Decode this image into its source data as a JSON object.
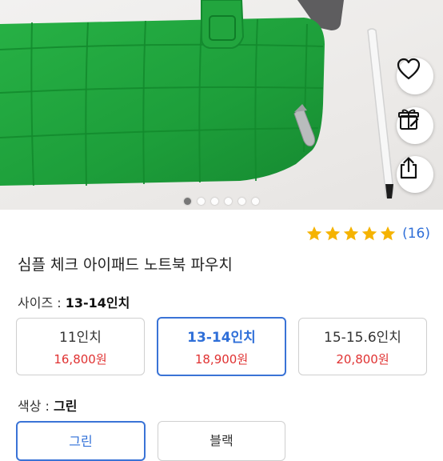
{
  "product": {
    "title": "심플 체크 아이패드 노트북 파우치",
    "rating": {
      "stars": 5,
      "review_count": "(16)"
    },
    "image_dots": {
      "count": 6,
      "active_index": 0
    }
  },
  "size_option": {
    "label": "사이즈 : ",
    "selected": "13-14인치",
    "choices": [
      {
        "name": "11인치",
        "price": "16,800원"
      },
      {
        "name": "13-14인치",
        "price": "18,900원"
      },
      {
        "name": "15-15.6인치",
        "price": "20,800원"
      }
    ]
  },
  "color_option": {
    "label": "색상 : ",
    "selected": "그린",
    "choices": [
      {
        "name": "그린"
      },
      {
        "name": "블랙"
      }
    ]
  },
  "colors": {
    "accent_blue": "#3a73d6",
    "price_red": "#e03232",
    "star_gold": "#f5b301",
    "pouch_green": "#1fa33a"
  },
  "icons": [
    "heart-icon",
    "gift-icon",
    "share-icon",
    "star-icon"
  ]
}
